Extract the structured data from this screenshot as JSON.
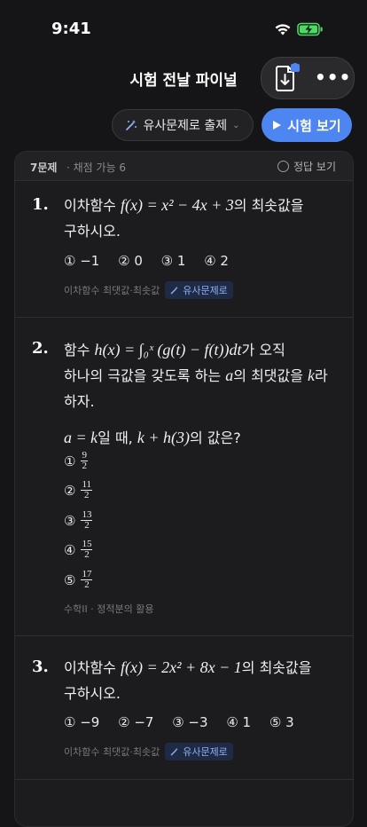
{
  "status": {
    "time": "9:41"
  },
  "nav": {
    "title": "시험 전날 파이널",
    "more": "•••"
  },
  "toolbar": {
    "similar_label": "유사문제로 출제",
    "exam_label": "시험 보기"
  },
  "list_header": {
    "count": "7문제",
    "gradable": "· 채점 가능 6",
    "show_answer": "정답 보기"
  },
  "questions": [
    {
      "num": "1.",
      "line1_a": "이차함수 ",
      "line1_math": "f(x) = x² − 4x + 3",
      "line1_b": "의 최솟값을",
      "line2": "구하시오.",
      "choices": [
        "① −1",
        "② 0",
        "③ 1",
        "④ 2"
      ],
      "tag": "이차함수 최댓값·최솟값",
      "badge": "유사문제로"
    },
    {
      "num": "2.",
      "line1_a": "함수 ",
      "line1_math": "h(x) = ∫₀ˣ (g(t) − f(t))dt",
      "line1_b": "가 오직",
      "line2_a": "하나의 극값을 갖도록 하는 ",
      "line2_m1": "a",
      "line2_b": "의 최댓값을 ",
      "line2_m2": "k",
      "line2_c": "라",
      "line3": "하자.",
      "line4_math": "a = k",
      "line4_a": "일 때, ",
      "line4_math2": "k + h(3)",
      "line4_b": "의 값은?",
      "choices": [
        {
          "mark": "①",
          "num": "9",
          "den": "2"
        },
        {
          "mark": "②",
          "num": "11",
          "den": "2"
        },
        {
          "mark": "③",
          "num": "13",
          "den": "2"
        },
        {
          "mark": "④",
          "num": "15",
          "den": "2"
        },
        {
          "mark": "⑤",
          "num": "17",
          "den": "2"
        }
      ],
      "tag": "수학II · 정적분의 활용"
    },
    {
      "num": "3.",
      "line1_a": "이차함수 ",
      "line1_math": "f(x) = 2x² + 8x − 1",
      "line1_b": "의 최솟값을",
      "line2": "구하시오.",
      "choices": [
        "① −9",
        "② −7",
        "③ −3",
        "④ 1",
        "⑤ 3"
      ],
      "tag": "이차함수 최댓값·최솟값",
      "badge": "유사문제로"
    }
  ],
  "colors": {
    "accent": "#4e86f1",
    "background": "#151517",
    "card": "#1c1c1f",
    "badge_text": "#8fb0f5"
  }
}
